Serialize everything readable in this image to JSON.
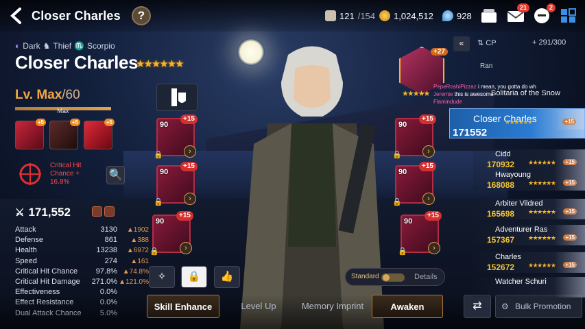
{
  "header": {
    "back_label": "back",
    "title": "Closer Charles",
    "help": "?"
  },
  "resources": {
    "stamina": "121",
    "stamina_max": "/154",
    "gold": "1,024,512",
    "skystone": "928"
  },
  "top_icons": {
    "mail_badge": "21",
    "news_badge": "2"
  },
  "hero": {
    "element": "Dark",
    "class": "Thief",
    "zodiac": "Scorpio",
    "name": "Closer Charles",
    "stars": "★★★★★★",
    "level": "Lv. Max",
    "level_max": "/60",
    "level_bar_label": "Max",
    "skills": [
      {
        "plus": "+5"
      },
      {
        "plus": "+5"
      },
      {
        "plus": "+5"
      }
    ],
    "exclusive_effect": [
      "Critical Hit",
      "Chance +",
      "16.8%"
    ],
    "cp": "171,552",
    "stats": [
      {
        "name": "Attack",
        "value": "3130",
        "bonus": "1902"
      },
      {
        "name": "Defense",
        "value": "861",
        "bonus": "388"
      },
      {
        "name": "Health",
        "value": "13238",
        "bonus": "6972"
      },
      {
        "name": "Speed",
        "value": "274",
        "bonus": "161"
      },
      {
        "name": "Critical Hit Chance",
        "value": "97.8%",
        "bonus": "74.8%"
      },
      {
        "name": "Critical Hit Damage",
        "value": "271.0%",
        "bonus": "121.0%"
      },
      {
        "name": "Effectiveness",
        "value": "0.0%",
        "bonus": ""
      },
      {
        "name": "Effect Resistance",
        "value": "0.0%",
        "bonus": ""
      },
      {
        "name": "Dual Attack Chance",
        "value": "5.0%",
        "bonus": ""
      }
    ]
  },
  "equipment": [
    {
      "level": "90",
      "plus": "+15"
    },
    {
      "level": "90",
      "plus": "+15"
    },
    {
      "level": "90",
      "plus": "+15"
    },
    {
      "level": "90",
      "plus": "+15"
    },
    {
      "level": "90",
      "plus": "+15"
    },
    {
      "level": "90",
      "plus": "+15"
    }
  ],
  "artifact": {
    "plus": "+27",
    "stars": "★★★★★"
  },
  "toggle": {
    "standard": "Standard",
    "details": "Details"
  },
  "tabs": {
    "skill_enhance": "Skill Enhance",
    "level_up": "Level Up",
    "memory_imprint": "Memory Imprint",
    "awaken": "Awaken",
    "bulk_promotion": "Bulk Promotion"
  },
  "roster_panel": {
    "sort": "CP",
    "count": "291/300",
    "chat": [
      {
        "user": "PepeRoshiPizzaz",
        "text": "i mean, you gotta do wh"
      },
      {
        "user": "Jeremie",
        "text": "this is awesome"
      },
      {
        "user": "Flamindude",
        "text": ""
      }
    ],
    "partial_top": [
      "Ran",
      "Solitaria of the Snow"
    ],
    "heroes": [
      {
        "name": "Closer Charles",
        "cp": "171552",
        "plus": "+15"
      },
      {
        "name": "Cidd",
        "cp": "170932",
        "plus": "+15"
      },
      {
        "name": "Hwayoung",
        "cp": "168088",
        "plus": "+15"
      },
      {
        "name": "Arbiter Vildred",
        "cp": "165698",
        "plus": "+15"
      },
      {
        "name": "Adventurer Ras",
        "cp": "157367",
        "plus": "+15"
      },
      {
        "name": "Charles",
        "cp": "152672",
        "plus": "+15"
      },
      {
        "name": "Watcher Schuri",
        "cp": "",
        "plus": ""
      }
    ]
  }
}
